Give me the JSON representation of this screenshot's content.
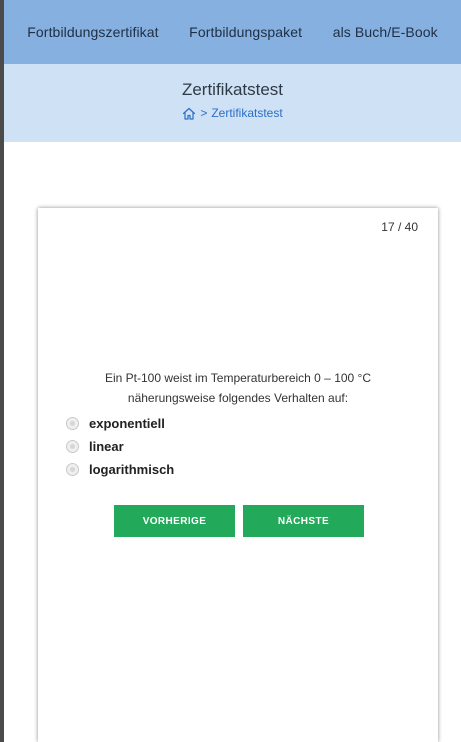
{
  "nav": {
    "items": [
      {
        "label": "Fortbildungszertifikat"
      },
      {
        "label": "Fortbildungspaket"
      },
      {
        "label": "als Buch/E-Book"
      }
    ]
  },
  "banner": {
    "title": "Zertifikatstest",
    "breadcrumb_separator": ">",
    "breadcrumb_current": "Zertifikatstest"
  },
  "quiz": {
    "counter": "17 / 40",
    "question_line1": "Ein Pt-100 weist im Temperaturbereich 0 – 100 °C",
    "question_line2": "näherungsweise folgendes Verhalten auf:",
    "options": [
      {
        "label": "exponentiell"
      },
      {
        "label": "linear"
      },
      {
        "label": "logarithmisch"
      }
    ],
    "prev_label": "VORHERIGE",
    "next_label": "NÄCHSTE"
  },
  "colors": {
    "nav_bg": "#85b0e0",
    "banner_bg": "#cfe1f4",
    "link": "#2b6fc6",
    "button_bg": "#22a95a"
  },
  "icons": {
    "breadcrumb_home": "home-icon",
    "option_marker": "radio-icon"
  }
}
